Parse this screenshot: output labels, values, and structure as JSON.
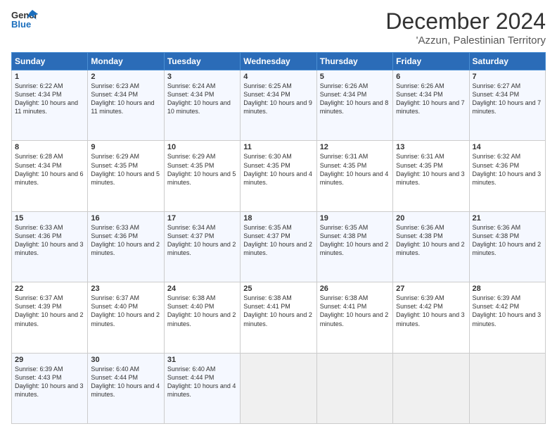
{
  "header": {
    "logo_general": "General",
    "logo_blue": "Blue",
    "title": "December 2024",
    "subtitle": "'Azzun, Palestinian Territory"
  },
  "days_of_week": [
    "Sunday",
    "Monday",
    "Tuesday",
    "Wednesday",
    "Thursday",
    "Friday",
    "Saturday"
  ],
  "weeks": [
    [
      {
        "day": "1",
        "sunrise": "6:22 AM",
        "sunset": "4:34 PM",
        "daylight": "10 hours and 11 minutes."
      },
      {
        "day": "2",
        "sunrise": "6:23 AM",
        "sunset": "4:34 PM",
        "daylight": "10 hours and 11 minutes."
      },
      {
        "day": "3",
        "sunrise": "6:24 AM",
        "sunset": "4:34 PM",
        "daylight": "10 hours and 10 minutes."
      },
      {
        "day": "4",
        "sunrise": "6:25 AM",
        "sunset": "4:34 PM",
        "daylight": "10 hours and 9 minutes."
      },
      {
        "day": "5",
        "sunrise": "6:26 AM",
        "sunset": "4:34 PM",
        "daylight": "10 hours and 8 minutes."
      },
      {
        "day": "6",
        "sunrise": "6:26 AM",
        "sunset": "4:34 PM",
        "daylight": "10 hours and 7 minutes."
      },
      {
        "day": "7",
        "sunrise": "6:27 AM",
        "sunset": "4:34 PM",
        "daylight": "10 hours and 7 minutes."
      }
    ],
    [
      {
        "day": "8",
        "sunrise": "6:28 AM",
        "sunset": "4:34 PM",
        "daylight": "10 hours and 6 minutes."
      },
      {
        "day": "9",
        "sunrise": "6:29 AM",
        "sunset": "4:35 PM",
        "daylight": "10 hours and 5 minutes."
      },
      {
        "day": "10",
        "sunrise": "6:29 AM",
        "sunset": "4:35 PM",
        "daylight": "10 hours and 5 minutes."
      },
      {
        "day": "11",
        "sunrise": "6:30 AM",
        "sunset": "4:35 PM",
        "daylight": "10 hours and 4 minutes."
      },
      {
        "day": "12",
        "sunrise": "6:31 AM",
        "sunset": "4:35 PM",
        "daylight": "10 hours and 4 minutes."
      },
      {
        "day": "13",
        "sunrise": "6:31 AM",
        "sunset": "4:35 PM",
        "daylight": "10 hours and 3 minutes."
      },
      {
        "day": "14",
        "sunrise": "6:32 AM",
        "sunset": "4:36 PM",
        "daylight": "10 hours and 3 minutes."
      }
    ],
    [
      {
        "day": "15",
        "sunrise": "6:33 AM",
        "sunset": "4:36 PM",
        "daylight": "10 hours and 3 minutes."
      },
      {
        "day": "16",
        "sunrise": "6:33 AM",
        "sunset": "4:36 PM",
        "daylight": "10 hours and 2 minutes."
      },
      {
        "day": "17",
        "sunrise": "6:34 AM",
        "sunset": "4:37 PM",
        "daylight": "10 hours and 2 minutes."
      },
      {
        "day": "18",
        "sunrise": "6:35 AM",
        "sunset": "4:37 PM",
        "daylight": "10 hours and 2 minutes."
      },
      {
        "day": "19",
        "sunrise": "6:35 AM",
        "sunset": "4:38 PM",
        "daylight": "10 hours and 2 minutes."
      },
      {
        "day": "20",
        "sunrise": "6:36 AM",
        "sunset": "4:38 PM",
        "daylight": "10 hours and 2 minutes."
      },
      {
        "day": "21",
        "sunrise": "6:36 AM",
        "sunset": "4:38 PM",
        "daylight": "10 hours and 2 minutes."
      }
    ],
    [
      {
        "day": "22",
        "sunrise": "6:37 AM",
        "sunset": "4:39 PM",
        "daylight": "10 hours and 2 minutes."
      },
      {
        "day": "23",
        "sunrise": "6:37 AM",
        "sunset": "4:40 PM",
        "daylight": "10 hours and 2 minutes."
      },
      {
        "day": "24",
        "sunrise": "6:38 AM",
        "sunset": "4:40 PM",
        "daylight": "10 hours and 2 minutes."
      },
      {
        "day": "25",
        "sunrise": "6:38 AM",
        "sunset": "4:41 PM",
        "daylight": "10 hours and 2 minutes."
      },
      {
        "day": "26",
        "sunrise": "6:38 AM",
        "sunset": "4:41 PM",
        "daylight": "10 hours and 2 minutes."
      },
      {
        "day": "27",
        "sunrise": "6:39 AM",
        "sunset": "4:42 PM",
        "daylight": "10 hours and 3 minutes."
      },
      {
        "day": "28",
        "sunrise": "6:39 AM",
        "sunset": "4:42 PM",
        "daylight": "10 hours and 3 minutes."
      }
    ],
    [
      {
        "day": "29",
        "sunrise": "6:39 AM",
        "sunset": "4:43 PM",
        "daylight": "10 hours and 3 minutes."
      },
      {
        "day": "30",
        "sunrise": "6:40 AM",
        "sunset": "4:44 PM",
        "daylight": "10 hours and 4 minutes."
      },
      {
        "day": "31",
        "sunrise": "6:40 AM",
        "sunset": "4:44 PM",
        "daylight": "10 hours and 4 minutes."
      },
      null,
      null,
      null,
      null
    ]
  ],
  "labels": {
    "sunrise": "Sunrise:",
    "sunset": "Sunset:",
    "daylight": "Daylight:"
  }
}
